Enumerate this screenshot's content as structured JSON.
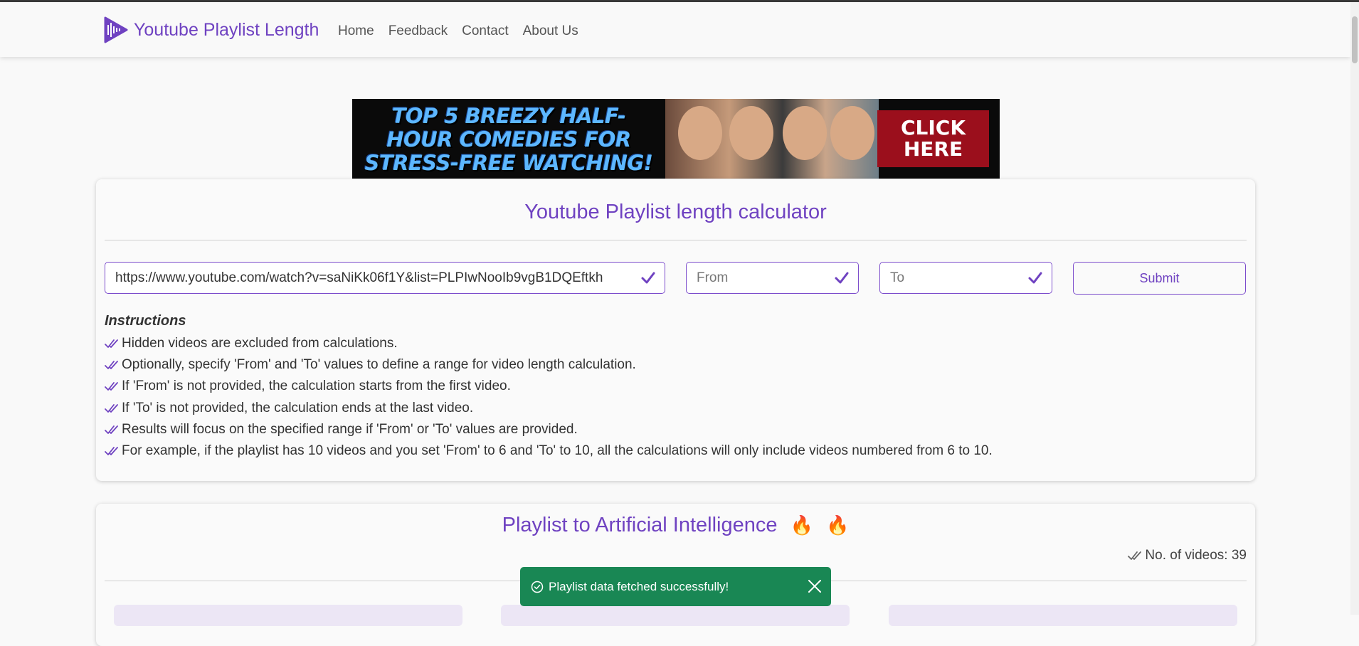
{
  "navbar": {
    "brand": "Youtube Playlist Length",
    "links": [
      "Home",
      "Feedback",
      "Contact",
      "About Us"
    ]
  },
  "ad": {
    "headline": "TOP 5 BREEZY HALF-HOUR COMEDIES FOR STRESS-FREE WATCHING!",
    "cta": "CLICK HERE"
  },
  "calculator": {
    "title": "Youtube Playlist length calculator",
    "url_value": "https://www.youtube.com/watch?v=saNiKk06f1Y&list=PLPIwNooIb9vgB1DQEftkh",
    "from_placeholder": "From",
    "to_placeholder": "To",
    "submit_label": "Submit",
    "instructions_title": "Instructions",
    "instructions": [
      "Hidden videos are excluded from calculations.",
      "Optionally, specify 'From' and 'To' values to define a range for video length calculation.",
      "If 'From' is not provided, the calculation starts from the first video.",
      "If 'To' is not provided, the calculation ends at the last video.",
      "Results will focus on the specified range if 'From' or 'To' values are provided.",
      "For example, if the playlist has 10 videos and you set 'From' to 6 and 'To' to 10, all the calculations will only include videos numbered from 6 to 10."
    ]
  },
  "playlist": {
    "title": "Playlist to Artificial Intelligence",
    "videos_label": "No. of videos: 39"
  },
  "toast": {
    "message": "Playlist data fetched successfully!"
  },
  "colors": {
    "accent": "#6f42c1",
    "toast_bg": "#198754"
  }
}
